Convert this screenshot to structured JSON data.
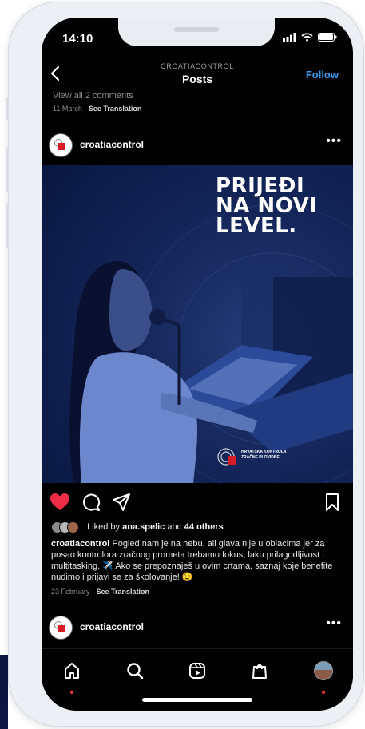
{
  "status_bar": {
    "time": "14:10"
  },
  "header": {
    "account": "CROATIACONTROL",
    "title": "Posts",
    "follow_label": "Follow"
  },
  "previous_post": {
    "view_comments": "View all 2 comments",
    "date": "11 March",
    "see_translation": "See Translation"
  },
  "post": {
    "username": "croatiacontrol",
    "more_label": "•••",
    "image_headline": [
      "PRIJEĐI",
      "NA NOVI",
      "LEVEL."
    ],
    "image_logo_text": [
      "HRVATSKA KONTROLA",
      "ZRAČNE PLOVIDBE"
    ],
    "liked_prefix": "Liked by",
    "liked_user": "ana.spelic",
    "liked_mid": "and",
    "liked_others": "44 others",
    "caption_user": "croatiacontrol",
    "caption_text": "Pogled nam je na nebu, ali glava nije u oblacima jer za posao kontrolora zračnog prometa trebamo fokus, laku prilagodljivost i multitasking. ✈️ Ako se prepoznaješ u ovim crtama, saznaj koje benefite nudimo i prijavi se za školovanje! 😉",
    "date": "23 February",
    "see_translation": "See Translation",
    "like_color": "#ed2d45"
  },
  "next_post": {
    "username": "croatiacontrol",
    "more_label": "•••"
  },
  "accent": "#3d9cf2"
}
